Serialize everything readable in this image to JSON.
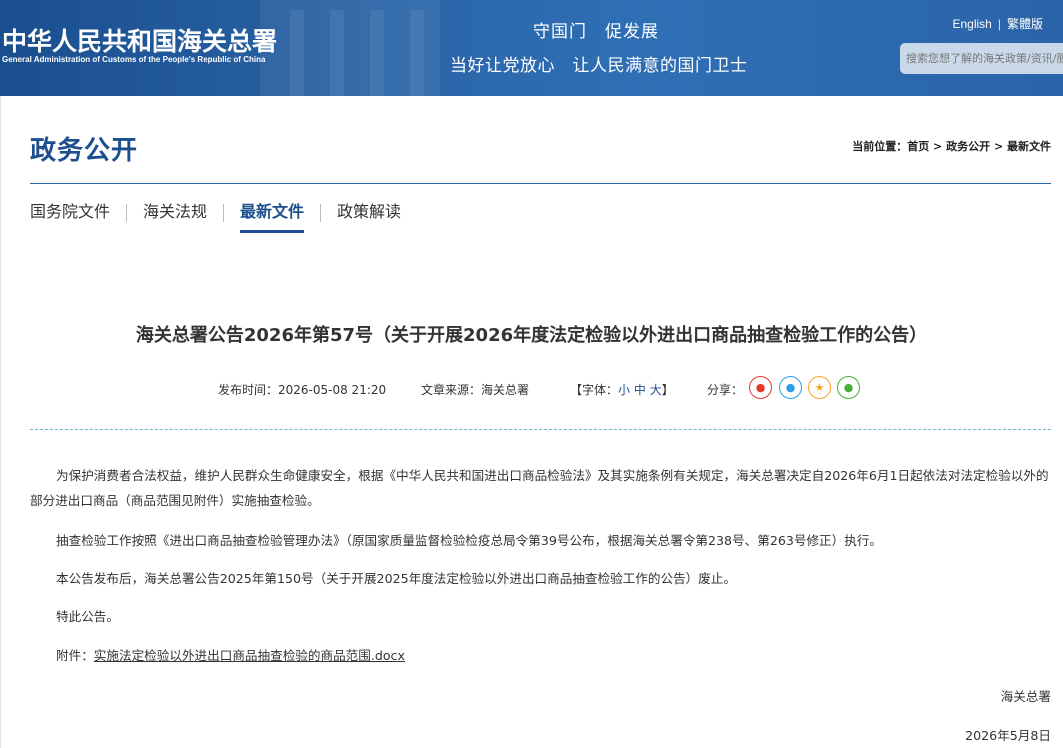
{
  "header": {
    "logo_cn": "中华人民共和国海关总署",
    "logo_en": "General Administration of Customs of the People's Republic of China",
    "slogan_line1": "守国门　促发展",
    "slogan_line2": "当好让党放心　让人民满意的国门卫士",
    "lang_english": "English",
    "lang_separator": "|",
    "lang_traditional": "繁體版",
    "search_placeholder": "搜索您想了解的海关政策/资讯/服务"
  },
  "section": {
    "title": "政务公开",
    "breadcrumb_prefix": "当前位置：",
    "crumbs": [
      "首页",
      "政务公开",
      "最新文件"
    ],
    "crumb_sep": " > "
  },
  "tabs": [
    {
      "label": "国务院文件",
      "active": false
    },
    {
      "label": "海关法规",
      "active": false
    },
    {
      "label": "最新文件",
      "active": true
    },
    {
      "label": "政策解读",
      "active": false
    }
  ],
  "article": {
    "title": "海关总署公告2026年第57号（关于开展2026年度法定检验以外进出口商品抽查检验工作的公告）",
    "publish_time": "发布时间：2026-05-08 21:20",
    "source": "文章来源：海关总署",
    "font_label_open": "【字体：",
    "font_small": "小",
    "font_medium": "中",
    "font_large": "大",
    "font_label_close": "】",
    "share_label": "分享：",
    "share_icons": [
      "weibo-icon",
      "qq-icon",
      "qzone-icon",
      "wechat-icon"
    ],
    "paragraphs": [
      "为保护消费者合法权益，维护人民群众生命健康安全，根据《中华人民共和国进出口商品检验法》及其实施条例有关规定，海关总署决定自2026年6月1日起依法对法定检验以外的部分进出口商品（商品范围见附件）实施抽查检验。",
      "抽查检验工作按照《进出口商品抽查检验管理办法》（原国家质量监督检验检疫总局令第39号公布，根据海关总署令第238号、第263号修正）执行。",
      "本公告发布后，海关总署公告2025年第150号（关于开展2025年度法定检验以外进出口商品抽查检验工作的公告）废止。",
      "特此公告。"
    ],
    "attachment_label": "附件：",
    "attachment_link": "实施法定检验以外进出口商品抽查检验的商品范围.docx",
    "signature_org": "海关总署",
    "signature_date": "2026年5月8日"
  },
  "colors": {
    "brand_blue": "#1d4f8e",
    "banner_blue": "#2a63a6",
    "weibo": "#e6362c",
    "qq": "#2a9ee8",
    "qzone": "#f5a623",
    "wechat": "#45b035"
  }
}
